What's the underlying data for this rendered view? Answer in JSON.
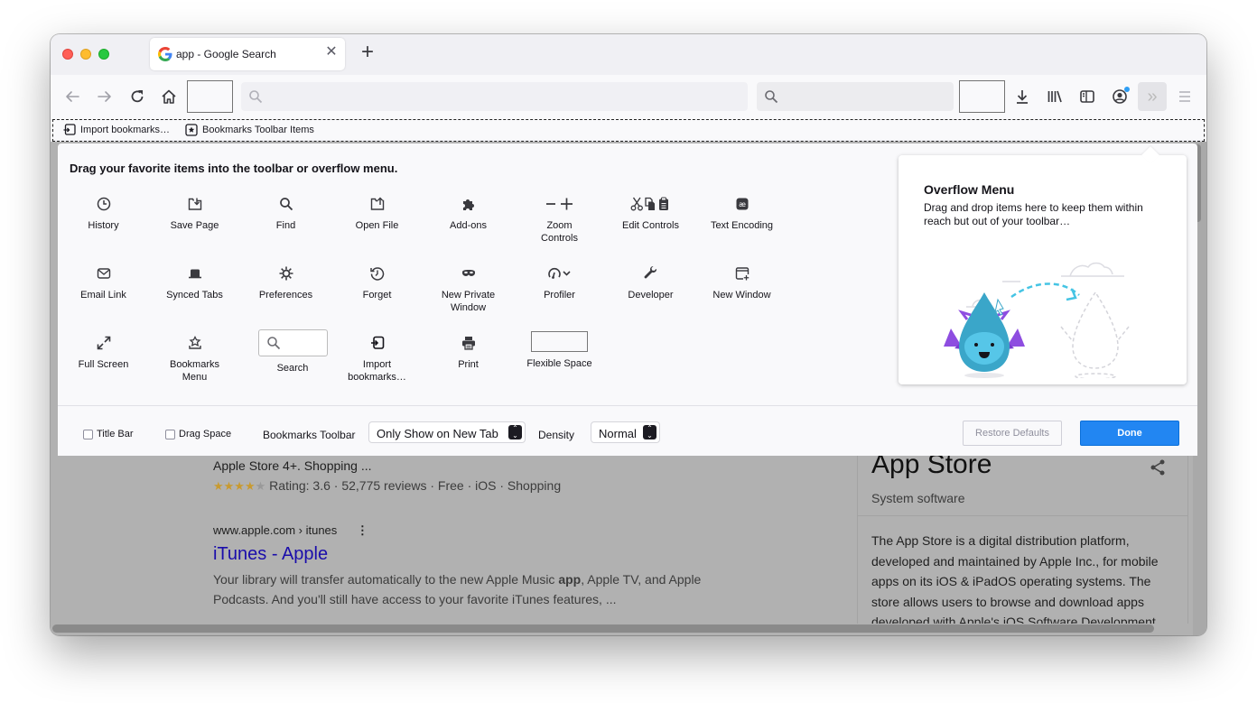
{
  "browser": {
    "tab": {
      "title": "app - Google Search",
      "favicon": "google-g-icon"
    },
    "new_tab_icon": "plus-icon",
    "nav_icons": [
      "back-icon",
      "forward-icon",
      "reload-icon",
      "home-icon",
      "search-icon",
      "downloads-icon",
      "library-icon",
      "sidebar-icon",
      "account-icon",
      "overflow-chevrons-icon",
      "hamburger-menu-icon"
    ],
    "bookmarks_toolbar": [
      {
        "label": "Import bookmarks…",
        "icon": "import-icon"
      },
      {
        "label": "Bookmarks Toolbar Items",
        "icon": "bookmark-star-icon"
      }
    ]
  },
  "customize": {
    "hint": "Drag your favorite items into the toolbar or overflow menu.",
    "items": [
      {
        "label": "History",
        "icon": "clock-icon"
      },
      {
        "label": "Save Page",
        "icon": "save-page-icon"
      },
      {
        "label": "Find",
        "icon": "magnifier-icon"
      },
      {
        "label": "Open File",
        "icon": "open-file-icon"
      },
      {
        "label": "Add-ons",
        "icon": "puzzle-icon"
      },
      {
        "label": "Zoom Controls",
        "icon": "zoom-minus-plus-icon"
      },
      {
        "label": "Edit Controls",
        "icon": "cut-copy-paste-icon"
      },
      {
        "label": "Text Encoding",
        "icon": "text-encoding-icon"
      },
      {
        "label": "Email Link",
        "icon": "envelope-icon"
      },
      {
        "label": "Synced Tabs",
        "icon": "synced-tabs-icon"
      },
      {
        "label": "Preferences",
        "icon": "gear-icon"
      },
      {
        "label": "Forget",
        "icon": "forget-icon"
      },
      {
        "label": "New Private Window",
        "icon": "mask-icon"
      },
      {
        "label": "Profiler",
        "icon": "gauge-icon"
      },
      {
        "label": "Developer",
        "icon": "wrench-icon"
      },
      {
        "label": "New Window",
        "icon": "new-window-icon"
      },
      {
        "label": "Full Screen",
        "icon": "expand-icon"
      },
      {
        "label": "Bookmarks Menu",
        "icon": "bookmarks-menu-icon"
      },
      {
        "label": "Search",
        "icon": "search-box-icon"
      },
      {
        "label": "Import bookmarks…",
        "icon": "import-icon"
      },
      {
        "label": "Print",
        "icon": "printer-icon"
      },
      {
        "label": "Flexible Space",
        "icon": "flexible-space-icon"
      }
    ],
    "overflow": {
      "title": "Overflow Menu",
      "description": "Drag and drop items here to keep them within reach but out of your toolbar…"
    },
    "footer": {
      "title_bar_label": "Title Bar",
      "title_bar_checked": false,
      "drag_space_label": "Drag Space",
      "drag_space_checked": false,
      "bookmarks_toolbar_label": "Bookmarks Toolbar",
      "bookmarks_toolbar_value": "Only Show on New Tab",
      "density_label": "Density",
      "density_value": "Normal",
      "restore_label": "Restore Defaults",
      "done_label": "Done"
    }
  },
  "page": {
    "result1_snippet": "Apple Store 4+. Shopping ...",
    "result1_stars": "★★★★★",
    "result1_rating": 3.6,
    "result1_meta": "Rating: 3.6 · 52,775 reviews · Free · iOS · Shopping",
    "result2_url": "www.apple.com › itunes",
    "result2_title": "iTunes - Apple",
    "result2_line1_pre": "Your library will transfer automatically to the new Apple Music ",
    "result2_line1_bold": "app",
    "result2_line1_post": ", Apple TV, and Apple",
    "result2_line2": "Podcasts. And you'll still have access to your favorite iTunes features, ...",
    "kp_title": "App Store",
    "kp_subtitle": "System software",
    "kp_description": [
      "The App Store is a digital distribution platform,",
      "developed and maintained by Apple Inc., for mobile",
      "apps on its iOS & iPadOS operating systems. The",
      "store allows users to browse and download apps",
      "developed with Apple's iOS Software Development"
    ],
    "colors": {
      "link": "#1a0dab",
      "star": "#e7a300",
      "done_button": "#2286f2"
    }
  }
}
